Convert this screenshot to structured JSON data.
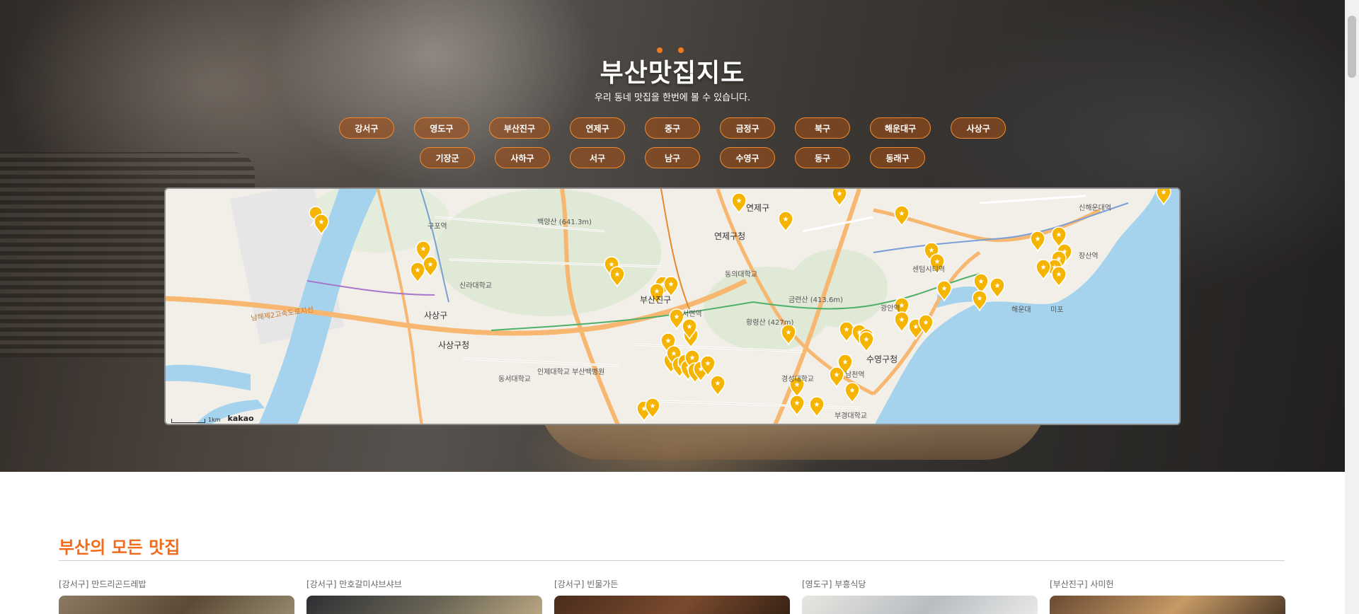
{
  "header": {
    "title": "부산맛집지도",
    "subtitle": "우리 동네 맛집을 한번에 볼 수 있습니다."
  },
  "districts_row1": [
    "강서구",
    "영도구",
    "부산진구",
    "연제구",
    "중구",
    "금정구",
    "북구",
    "해운대구",
    "사상구"
  ],
  "districts_row2": [
    "기장군",
    "사하구",
    "서구",
    "남구",
    "수영구",
    "동구",
    "동래구"
  ],
  "map": {
    "labels": {
      "yeonje": "연제구",
      "yeonje_office": "연제구청",
      "sasang": "사상구",
      "sasang_office": "사상구청",
      "busanjin": "부산진구",
      "suyeong_office": "수영구청",
      "seomyeon": "서면역",
      "baegyangsan": "백양산 (641.3m)",
      "hwangnyeongsan": "황령산 (427m)",
      "geumnyeonsan": "금련산 (413.6m)",
      "haeundae": "해운대",
      "centum": "센텀시티역",
      "mipo": "미포",
      "gupo": "구포역",
      "silla": "신라대학교",
      "dongeui": "동의대학교",
      "gyeongsung": "경성대학교",
      "bukyong": "부경대학교",
      "dongseo": "동서대학교",
      "inje": "인제대학교 부산백병원",
      "gwangan": "광안역",
      "namcheon": "남천역",
      "jangsan": "장산역",
      "sinhaeundae": "신해운대역",
      "namhae_road": "남해제2고속도로지선"
    },
    "scale_text": "1km",
    "attribution": "kakao"
  },
  "listing": {
    "title": "부산의 모든 맛집",
    "cards": [
      {
        "label": "[강서구] 만드리곤드레밥"
      },
      {
        "label": "[강서구] 만호갈미샤브샤브"
      },
      {
        "label": "[강서구] 빈물가든"
      },
      {
        "label": "[영도구] 부흥식당"
      },
      {
        "label": "[부산진구] 사미헌"
      }
    ]
  },
  "colors": {
    "accent": "#f06b1c",
    "marker": "#f5b400",
    "water": "#a5d3ee"
  }
}
